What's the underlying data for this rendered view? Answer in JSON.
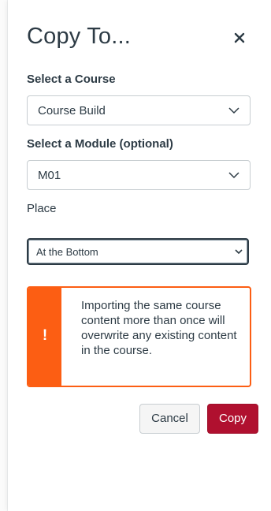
{
  "dialog": {
    "title": "Copy To...",
    "close_icon": "close-icon"
  },
  "course": {
    "label": "Select a Course",
    "value": "Course Build"
  },
  "module": {
    "label": "Select a Module (optional)",
    "value": "M01"
  },
  "place": {
    "label": "Place",
    "value": "At the Bottom"
  },
  "alert": {
    "icon": "exclamation-icon",
    "message": "Importing the same course content more than once will overwrite any existing content in the course."
  },
  "actions": {
    "cancel_label": "Cancel",
    "copy_label": "Copy"
  },
  "colors": {
    "warning": "#fc5e13",
    "primary": "#b0102f",
    "text": "#2d3b45"
  }
}
